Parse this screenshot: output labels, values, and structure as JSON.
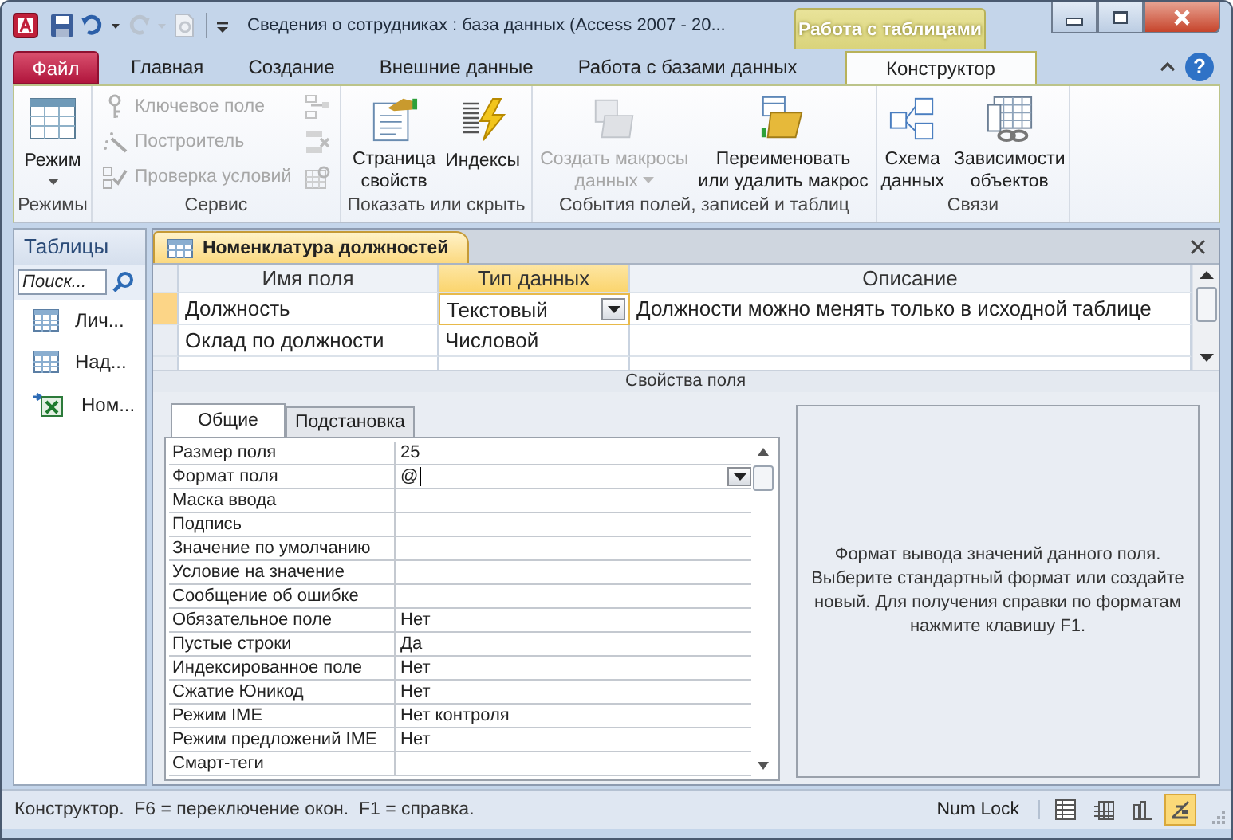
{
  "window": {
    "title": "Сведения о сотрудниках : база данных (Access 2007 - 20...",
    "context_tab": "Работа с таблицами"
  },
  "ribbon": {
    "tabs": [
      {
        "label": "Файл",
        "kind": "file",
        "selected": false
      },
      {
        "label": "Главная",
        "kind": "tab",
        "selected": false
      },
      {
        "label": "Создание",
        "kind": "tab",
        "selected": false
      },
      {
        "label": "Внешние данные",
        "kind": "tab",
        "selected": false
      },
      {
        "label": "Работа с базами данных",
        "kind": "tab",
        "selected": false
      },
      {
        "label": "Конструктор",
        "kind": "context",
        "selected": true
      }
    ],
    "help_button": "?",
    "groups": [
      {
        "label": "Режимы",
        "items": [
          {
            "kind": "large",
            "label": "Режим",
            "dropdown": true,
            "disabled": false
          }
        ]
      },
      {
        "label": "Сервис",
        "items": [
          {
            "kind": "small",
            "label": "Ключевое поле",
            "disabled": true
          },
          {
            "kind": "small",
            "label": "Построитель",
            "disabled": true
          },
          {
            "kind": "small",
            "label": "Проверка условий",
            "disabled": true
          },
          {
            "kind": "icon",
            "disabled": true
          },
          {
            "kind": "icon",
            "disabled": true
          },
          {
            "kind": "icon",
            "disabled": true
          }
        ]
      },
      {
        "label": "Показать или скрыть",
        "items": [
          {
            "kind": "large",
            "label": "Страница\nсвойств",
            "dropdown": false,
            "disabled": false
          },
          {
            "kind": "large",
            "label": "Индексы",
            "dropdown": false,
            "disabled": false
          }
        ]
      },
      {
        "label": "События полей, записей и таблиц",
        "items": [
          {
            "kind": "large",
            "label": "Создать макросы\nданных",
            "dropdown": true,
            "disabled": true
          },
          {
            "kind": "large",
            "label": "Переименовать\nили удалить макрос",
            "dropdown": false,
            "disabled": false
          }
        ]
      },
      {
        "label": "Связи",
        "items": [
          {
            "kind": "large",
            "label": "Схема\nданных",
            "dropdown": false,
            "disabled": false
          },
          {
            "kind": "large",
            "label": "Зависимости\nобъектов",
            "dropdown": false,
            "disabled": false
          }
        ]
      }
    ]
  },
  "nav": {
    "header": "Таблицы",
    "search": {
      "placeholder": "Поиск..."
    },
    "items": [
      {
        "label": "Лич...",
        "kind": "table"
      },
      {
        "label": "Над...",
        "kind": "table"
      },
      {
        "label": "Ном...",
        "kind": "linked"
      }
    ]
  },
  "document": {
    "tab": "Номенклатура должностей",
    "columns": [
      {
        "label": "Имя поля",
        "selected": false
      },
      {
        "label": "Тип данных",
        "selected": true
      },
      {
        "label": "Описание",
        "selected": false
      }
    ],
    "rows": [
      {
        "name": "Должность",
        "type": "Текстовый",
        "description": "Должности можно менять только в исходной таблице",
        "selected": true
      },
      {
        "name": "Оклад по должности",
        "type": "Числовой",
        "selected": false
      }
    ],
    "properties_title": "Свойства поля",
    "property_tabs": [
      {
        "label": "Общие",
        "selected": true
      },
      {
        "label": "Подстановка",
        "selected": false
      }
    ],
    "properties": [
      {
        "label": "Размер поля",
        "value": "25",
        "selected": false
      },
      {
        "label": "Формат поля",
        "value": "@",
        "selected": true
      },
      {
        "label": "Маска ввода",
        "selected": false
      },
      {
        "label": "Подпись",
        "selected": false
      },
      {
        "label": "Значение по умолчанию",
        "selected": false
      },
      {
        "label": "Условие на значение",
        "selected": false
      },
      {
        "label": "Сообщение об ошибке",
        "selected": false
      },
      {
        "label": "Обязательное поле",
        "value": "Нет",
        "selected": false
      },
      {
        "label": "Пустые строки",
        "value": "Да",
        "selected": false
      },
      {
        "label": "Индексированное поле",
        "value": "Нет",
        "selected": false
      },
      {
        "label": "Сжатие Юникод",
        "value": "Нет",
        "selected": false
      },
      {
        "label": "Режим IME",
        "value": "Нет контроля",
        "selected": false
      },
      {
        "label": "Режим предложений IME",
        "value": "Нет",
        "selected": false
      },
      {
        "label": "Смарт-теги",
        "selected": false
      }
    ],
    "help": "Формат вывода значений данного поля. Выберите стандартный формат или создайте новый. Для получения справки по форматам нажмите клавишу F1."
  },
  "status_bar": {
    "text": "Конструктор.  F6 = переключение окон.  F1 = справка.",
    "num_lock": "Num Lock",
    "views": [
      {
        "selected": false
      },
      {
        "selected": false
      },
      {
        "selected": false
      },
      {
        "selected": true
      }
    ]
  }
}
